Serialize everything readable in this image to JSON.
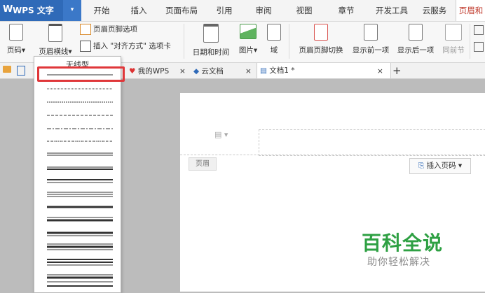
{
  "app": {
    "logo": "W",
    "name": "WPS 文字",
    "drop": "▾"
  },
  "menu_tabs": [
    "开始",
    "插入",
    "页面布局",
    "引用",
    "审阅",
    "视图",
    "章节",
    "开发工具",
    "云服务",
    "页眉和"
  ],
  "ribbon": {
    "page_number": "页码",
    "header_line": "页眉横线",
    "header_footer_options": "页眉页脚选项",
    "insert_align_tab": "插入 \"对齐方式\" 选项卡",
    "date_time": "日期和时间",
    "picture": "图片",
    "field": "域",
    "switch_header_footer": "页眉页脚切换",
    "show_previous": "显示前一项",
    "show_next": "显示后一项",
    "same_as_previous": "同前节",
    "caret": "▾"
  },
  "doc_tabs": [
    {
      "label": "我的WPS",
      "close": "×"
    },
    {
      "label": "云文档",
      "close": "×"
    },
    {
      "label": "文档1 *",
      "close": "×"
    }
  ],
  "new_tab": "+",
  "document": {
    "header_label": "页眉",
    "insert_page_number": "插入页码",
    "watermark_title": "百科全说",
    "watermark_subtitle": "助你轻松解决"
  },
  "dropdown": {
    "title": "无线型",
    "options": [
      "single-thin",
      "dotted",
      "dashed",
      "dash-dot",
      "dash-dot-dot",
      "double",
      "thin-thick",
      "thick-thin",
      "double-thick",
      "triple",
      "thick",
      "thin-thick-thin",
      "wide",
      "thick-thin-thick",
      "triple-wide",
      "quad"
    ]
  },
  "colors": {
    "accent": "#2f6ab8",
    "highlight": "#e0373a",
    "watermark": "#2ea043"
  }
}
